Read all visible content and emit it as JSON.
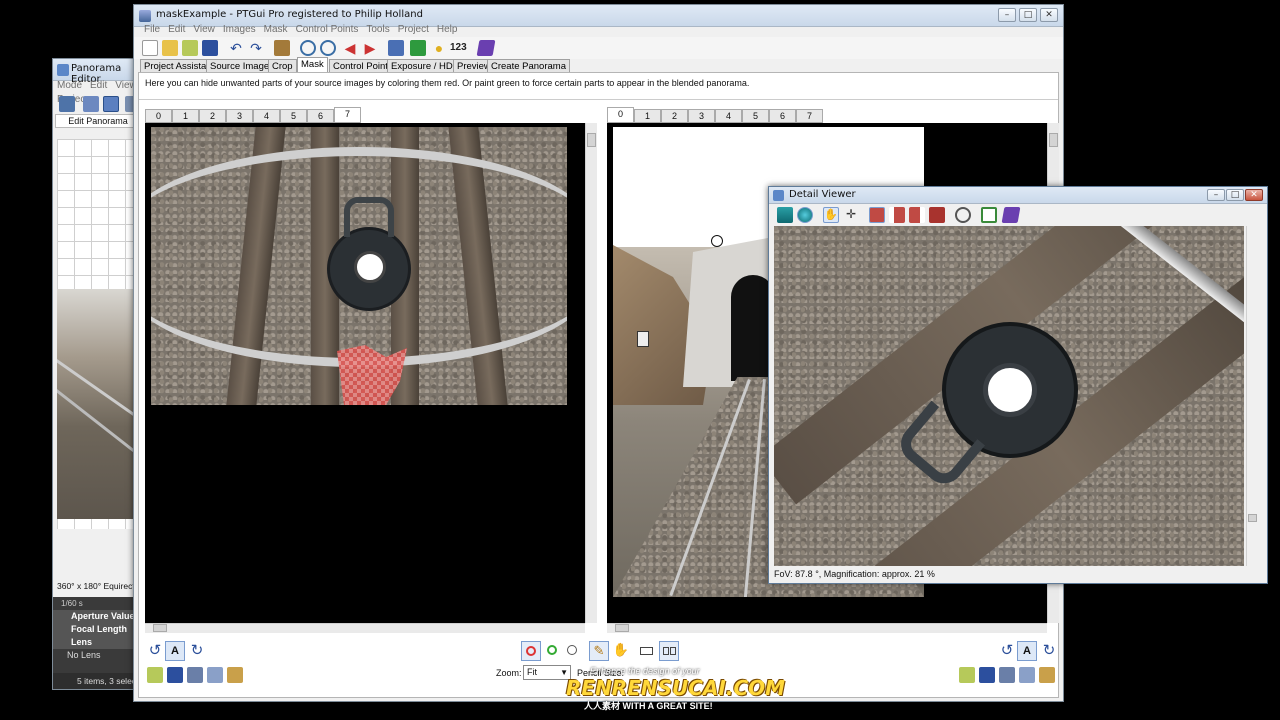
{
  "panorama_editor": {
    "title": "Panorama Editor",
    "menu": [
      "Mode",
      "Edit",
      "View",
      "Projec"
    ],
    "tab_label": "Edit Panorama",
    "projection": "360° x 180° Equirectar",
    "rows": [
      {
        "label": "1/60 s",
        "type": "value"
      },
      {
        "label": "Aperture Value",
        "type": "header"
      },
      {
        "label": "Focal Length",
        "type": "header"
      },
      {
        "label": "Lens",
        "type": "header"
      },
      {
        "label": "No Lens",
        "type": "value"
      }
    ],
    "status": "5 items, 3 selecte"
  },
  "main": {
    "title": "maskExample - PTGui Pro registered to Philip Holland",
    "menu": [
      "File",
      "Edit",
      "View",
      "Images",
      "Mask",
      "Control Points",
      "Tools",
      "Project",
      "Help"
    ],
    "toolbar_counter": "123",
    "tabs": [
      "Project Assistant",
      "Source Images",
      "Crop",
      "Mask",
      "Control Points",
      "Exposure / HDR",
      "Preview",
      "Create Panorama"
    ],
    "active_tab": "Mask",
    "instructions": "Here you can hide unwanted parts of your source images by coloring them red. Or paint green to force certain parts to appear in the blended panorama.",
    "left_image_tabs": [
      "0",
      "1",
      "2",
      "3",
      "4",
      "5",
      "6",
      "7"
    ],
    "left_active": "7",
    "right_image_tabs": [
      "0",
      "1",
      "2",
      "3",
      "4",
      "5",
      "6",
      "7"
    ],
    "right_active": "0",
    "zoom_label": "Zoom:",
    "zoom_value": "Fit",
    "pencil_label": "Pencil Size:",
    "mode_button": "A"
  },
  "detail_viewer": {
    "title": "Detail Viewer",
    "status": "FoV: 87.8 °, Magnification: approx. 21 %"
  },
  "watermark": {
    "text": "RENRENSUCAI.COM",
    "tagline": "Enhance the design of your",
    "sub": "人人素材 WITH A GREAT SITE!"
  },
  "colors": {
    "mask_red": "#d9534f",
    "accent_blue": "#3a6ea5"
  }
}
